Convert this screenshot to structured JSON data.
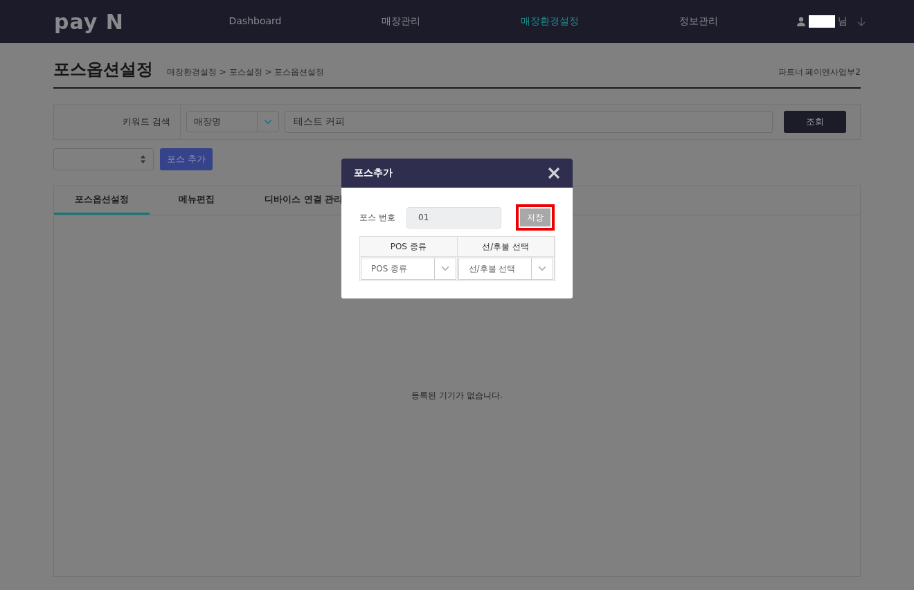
{
  "header": {
    "logo": "pay N",
    "nav": [
      {
        "label": "Dashboard",
        "selected": false
      },
      {
        "label": "매장관리",
        "selected": false
      },
      {
        "label": "매장환경설정",
        "selected": true
      },
      {
        "label": "정보관리",
        "selected": false
      }
    ],
    "user_suffix": "님"
  },
  "page": {
    "title": "포스옵션설정",
    "breadcrumb": "매장환경설정 > 포스설정 > 포스옵션설정",
    "partner": "파트너 페이엔사업부2"
  },
  "search": {
    "label": "키워드 검색",
    "field_select": "매장명",
    "keyword": "테스트 커피",
    "button": "조회"
  },
  "toolbar": {
    "add_button": "포스 추가"
  },
  "tabs": [
    {
      "label": "포스옵션설정",
      "selected": true
    },
    {
      "label": "메뉴편집",
      "selected": false
    },
    {
      "label": "디바이스 연결 관리",
      "selected": false
    }
  ],
  "empty_message": "등록된 기기가 없습니다.",
  "dialog": {
    "title": "포스추가",
    "pos_number_label": "포스 번호",
    "pos_number": "01",
    "save_button": "저장",
    "save_highlighted": true,
    "columns": [
      "POS 종류",
      "선/후불 선택"
    ],
    "selects": [
      "POS 종류",
      "선/후불 선택"
    ]
  }
}
